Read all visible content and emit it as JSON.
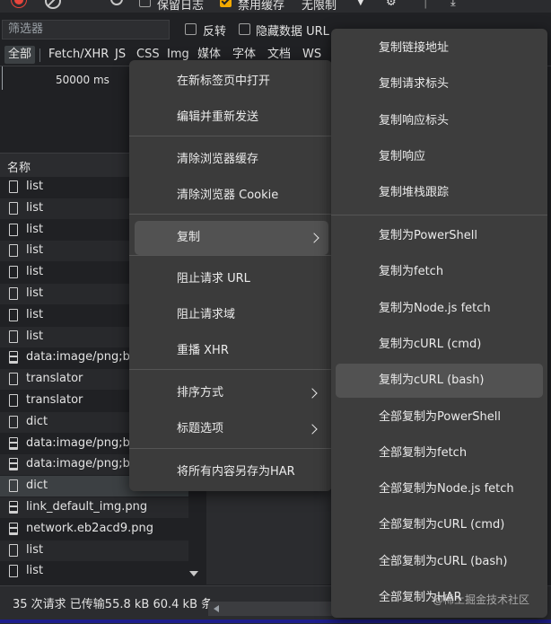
{
  "toolbar": {
    "preserve_log": "保留日志",
    "disable_cache": "禁用缓存",
    "throttling": "无限制"
  },
  "filter": {
    "placeholder": "筛选器",
    "invert": "反转",
    "hide_data_urls": "隐藏数据 URL"
  },
  "type_tabs": [
    "全部",
    "Fetch/XHR",
    "JS",
    "CSS",
    "Img",
    "媒体",
    "字体",
    "文档",
    "WS"
  ],
  "timeline": {
    "label": "50000 ms"
  },
  "list": {
    "header": "名称",
    "rows": [
      {
        "name": "list",
        "kind": "doc"
      },
      {
        "name": "list",
        "kind": "doc"
      },
      {
        "name": "list",
        "kind": "doc"
      },
      {
        "name": "list",
        "kind": "doc"
      },
      {
        "name": "list",
        "kind": "doc"
      },
      {
        "name": "list",
        "kind": "doc"
      },
      {
        "name": "list",
        "kind": "doc"
      },
      {
        "name": "list",
        "kind": "doc"
      },
      {
        "name": "data:image/png;base",
        "kind": "img"
      },
      {
        "name": "translator",
        "kind": "doc"
      },
      {
        "name": "translator",
        "kind": "doc"
      },
      {
        "name": "dict",
        "kind": "doc"
      },
      {
        "name": "data:image/png;base",
        "kind": "img"
      },
      {
        "name": "data:image/png;base",
        "kind": "img"
      },
      {
        "name": "dict",
        "kind": "doc",
        "selected": true
      },
      {
        "name": "link_default_img.png",
        "kind": "img"
      },
      {
        "name": "network.eb2acd9.png",
        "kind": "img"
      },
      {
        "name": "list",
        "kind": "doc"
      },
      {
        "name": "list",
        "kind": "doc"
      }
    ]
  },
  "status": {
    "text": "35 次请求  已传输55.8 kB  60.4 kB 条"
  },
  "context_menu": {
    "items": [
      {
        "label": "在新标签页中打开"
      },
      {
        "label": "编辑并重新发送"
      },
      {
        "label": "清除浏览器缓存"
      },
      {
        "label": "清除浏览器 Cookie"
      },
      {
        "label": "复制",
        "submenu": true,
        "highlighted": true
      },
      {
        "label": "阻止请求 URL"
      },
      {
        "label": "阻止请求域"
      },
      {
        "label": "重播 XHR"
      },
      {
        "label": "排序方式",
        "submenu": true
      },
      {
        "label": "标题选项",
        "submenu": true
      },
      {
        "label": "将所有内容另存为HAR"
      }
    ]
  },
  "copy_submenu": {
    "items": [
      {
        "label": "复制链接地址"
      },
      {
        "label": "复制请求标头"
      },
      {
        "label": "复制响应标头"
      },
      {
        "label": "复制响应"
      },
      {
        "label": "复制堆栈跟踪"
      },
      {
        "label": "复制为PowerShell"
      },
      {
        "label": "复制为fetch"
      },
      {
        "label": "复制为Node.js fetch"
      },
      {
        "label": "复制为cURL (cmd)"
      },
      {
        "label": "复制为cURL (bash)",
        "highlighted": true
      },
      {
        "label": "全部复制为PowerShell"
      },
      {
        "label": "全部复制为fetch"
      },
      {
        "label": "全部复制为Node.js fetch"
      },
      {
        "label": "全部复制为cURL (cmd)"
      },
      {
        "label": "全部复制为cURL (bash)"
      },
      {
        "label": "全部复制为HAR"
      }
    ]
  },
  "watermark": "@稀土掘金技术社区"
}
